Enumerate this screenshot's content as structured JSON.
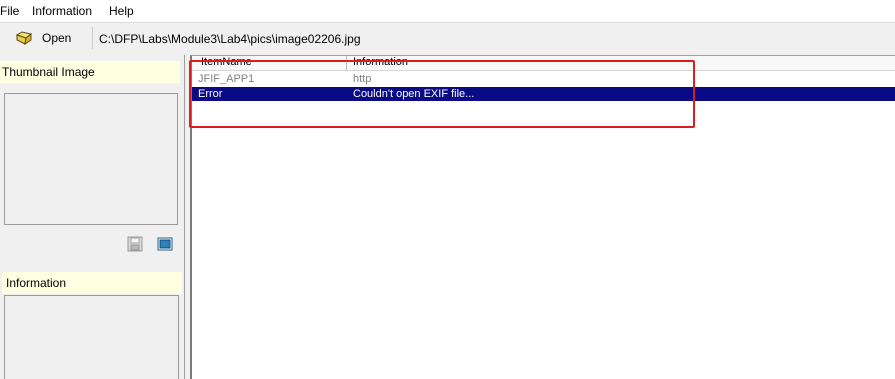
{
  "menu": {
    "items": [
      "File",
      "Information",
      "Help"
    ]
  },
  "toolbar": {
    "open_label": "Open",
    "path": "C:\\DFP\\Labs\\Module3\\Lab4\\pics\\image02206.jpg"
  },
  "left_panel": {
    "thumbnail_header": "Thumbnail Image",
    "information_header": "Information"
  },
  "table": {
    "columns": [
      "ItemName",
      "Information"
    ],
    "rows": [
      {
        "item_name": "JFIF_APP1",
        "information": "http",
        "selected": false
      },
      {
        "item_name": "Error",
        "information": "Couldn't open EXIF file...",
        "selected": true
      }
    ]
  },
  "colors": {
    "selection": "#0a0a87",
    "annotation_box": "#d81e1e",
    "section_header_bg": "#ffffe1"
  },
  "icons": [
    "open-folder-icon",
    "save-icon",
    "view-image-icon"
  ]
}
